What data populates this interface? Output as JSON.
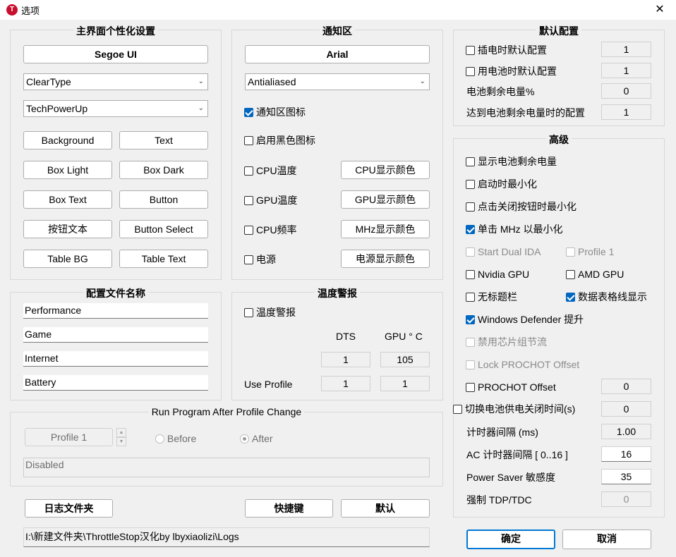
{
  "window": {
    "title": "选项",
    "close": "✕"
  },
  "ui_group": {
    "title": "主界面个性化设置",
    "font_button": "Segoe UI",
    "cleartype": "ClearType",
    "skin": "TechPowerUp",
    "colors": [
      "Background",
      "Text",
      "Box Light",
      "Box Dark",
      "Box Text",
      "Button",
      "按钮文本",
      "Button Select",
      "Table BG",
      "Table Text"
    ]
  },
  "notify_group": {
    "title": "通知区",
    "font_button": "Arial",
    "aa": "Antialiased",
    "tray_icon": "通知区图标",
    "dark_icon": "启用黑色图标",
    "cpu_temp": "CPU温度",
    "cpu_color": "CPU显示颜色",
    "gpu_temp": "GPU温度",
    "gpu_color": "GPU显示颜色",
    "cpu_freq": "CPU频率",
    "mhz_color": "MHz显示颜色",
    "power": "电源",
    "power_color": "电源显示颜色"
  },
  "default_group": {
    "title": "默认配置",
    "ac": "插电时默认配置",
    "ac_val": "1",
    "battery": "用电池时默认配置",
    "battery_val": "1",
    "remain": "电池剩余电量%",
    "remain_val": "0",
    "reach": "达到电池剩余电量时的配置",
    "reach_val": "1"
  },
  "advanced_group": {
    "title": "高级",
    "show_battery": "显示电池剩余电量",
    "start_min": "启动时最小化",
    "close_min": "点击关闭按钮时最小化",
    "mhz_min": "单击 MHz 以最小化",
    "dual_ida": "Start Dual IDA",
    "profile1": "Profile 1",
    "nvidia": "Nvidia GPU",
    "amd": "AMD GPU",
    "no_title": "无标题栏",
    "grid": "数据表格线显示",
    "defender": "Windows Defender 提升",
    "chipset": "禁用芯片组节流",
    "lock_prochot": "Lock PROCHOT Offset",
    "prochot": "PROCHOT Offset",
    "prochot_val": "0",
    "battery_off": "切换电池供电关闭时间(s)",
    "battery_off_val": "0",
    "timer": "计时器间隔 (ms)",
    "timer_val": "1.00",
    "ac_timer": "AC 计时器间隔 [ 0..16 ]",
    "ac_timer_val": "16",
    "power_saver": "Power Saver 敏感度",
    "power_saver_val": "35",
    "tdp": "强制 TDP/TDC",
    "tdp_val": "0"
  },
  "profile_group": {
    "title": "配置文件名称",
    "names": [
      "Performance",
      "Game",
      "Internet",
      "Battery"
    ]
  },
  "alarm_group": {
    "title": "温度警报",
    "enable": "温度警报",
    "dts": "DTS",
    "gpu": "GPU ° C",
    "dts_val": "1",
    "gpu_val": "105",
    "use_profile": "Use Profile",
    "use_dts": "1",
    "use_gpu": "1"
  },
  "run_group": {
    "title": "Run Program After Profile Change",
    "profile": "Profile 1",
    "before": "Before",
    "after": "After",
    "path": "Disabled"
  },
  "bottom": {
    "log_folder": "日志文件夹",
    "hotkey": "快捷键",
    "default": "默认",
    "log_path": "I:\\新建文件夹\\ThrottleStop汉化by lbyxiaolizi\\Logs",
    "ok": "确定",
    "cancel": "取消"
  }
}
